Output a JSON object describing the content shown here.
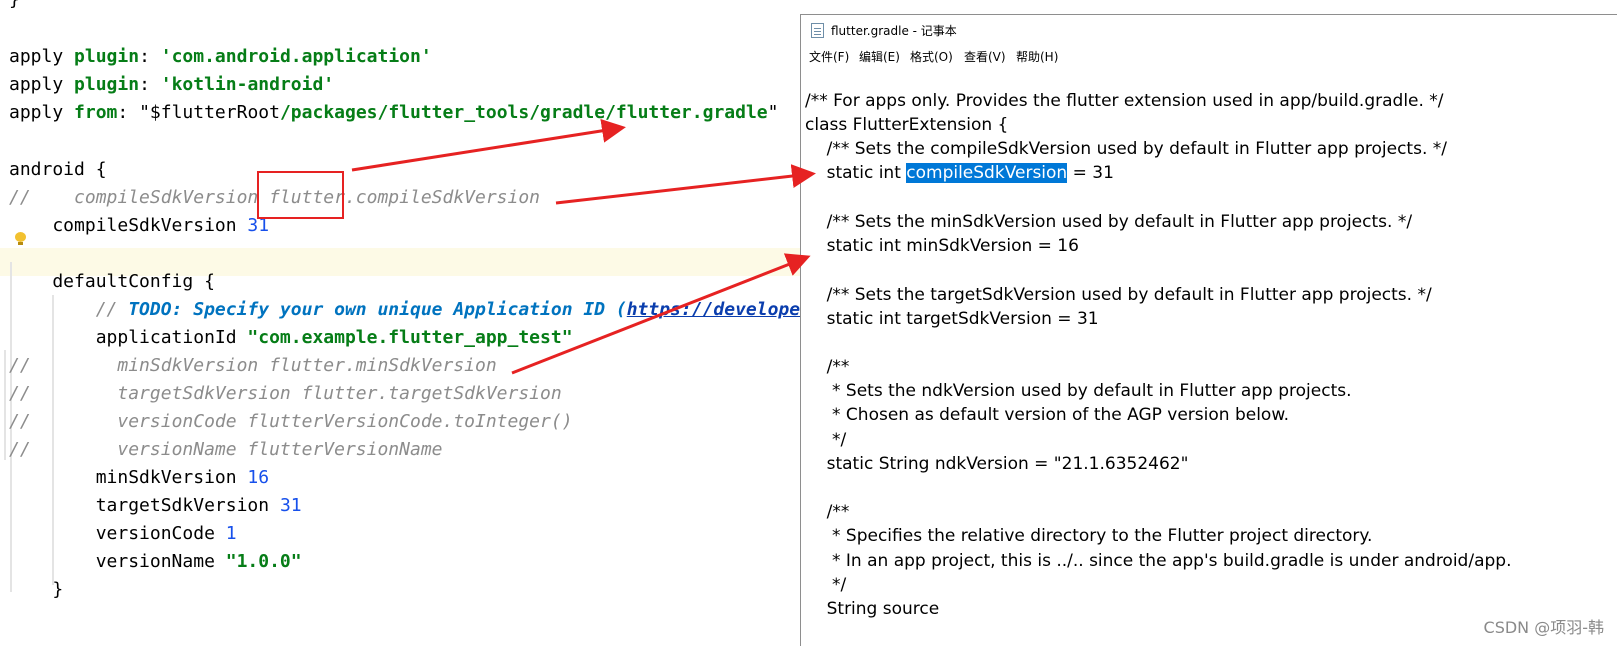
{
  "editor": {
    "line0": "}",
    "l1": {
      "a": "apply ",
      "b": "plugin",
      "c": ": ",
      "d": "'com.android.application'"
    },
    "l2": {
      "a": "apply ",
      "b": "plugin",
      "c": ": ",
      "d": "'kotlin-android'"
    },
    "l3": {
      "a": "apply ",
      "b": "from",
      "c": ": ",
      "d": "\"$flutterRoot",
      "e": "/packages/flutter_tools/gradle/flutter.gradle",
      "f": "\""
    },
    "l4": "android {",
    "l5": {
      "a": "//",
      "b": "    compileSdkVersion flutter.compileSdkVersion"
    },
    "l6": {
      "a": "    compileSdkVersion ",
      "b": "31"
    },
    "l7": "    defaultConfig {",
    "l8": {
      "a": "        // ",
      "b": "TODO: Specify your own unique Application ID (",
      "c": "https://developer"
    },
    "l9": {
      "a": "        applicationId ",
      "b": "\"com.example.flutter_app_test\""
    },
    "l10": {
      "a": "//",
      "b": "        minSdkVersion flutter.minSdkVersion"
    },
    "l11": {
      "a": "//",
      "b": "        targetSdkVersion flutter.targetSdkVersion"
    },
    "l12": {
      "a": "//",
      "b": "        versionCode flutterVersionCode.toInteger()"
    },
    "l13": {
      "a": "//",
      "b": "        versionName flutterVersionName"
    },
    "l14": {
      "a": "        minSdkVersion ",
      "b": "16"
    },
    "l15": {
      "a": "        targetSdkVersion ",
      "b": "31"
    },
    "l16": {
      "a": "        versionCode ",
      "b": "1"
    },
    "l17": {
      "a": "        versionName ",
      "b": "\"1.0.0\""
    },
    "l18": "    }"
  },
  "notepad": {
    "title": "flutter.gradle - 记事本",
    "menu": [
      "文件(F)",
      "编辑(E)",
      "格式(O)",
      "查看(V)",
      "帮助(H)"
    ],
    "lines": [
      "/** For apps only. Provides the flutter extension used in app/build.gradle. */",
      "class FlutterExtension {",
      "    /** Sets the compileSdkVersion used by default in Flutter app projects. */",
      "",
      "",
      "    /** Sets the minSdkVersion used by default in Flutter app projects. */",
      "    static int minSdkVersion = 16",
      "",
      "    /** Sets the targetSdkVersion used by default in Flutter app projects. */",
      "    static int targetSdkVersion = 31",
      "",
      "    /**",
      "     * Sets the ndkVersion used by default in Flutter app projects.",
      "     * Chosen as default version of the AGP version below.",
      "     */",
      "    static String ndkVersion = \"21.1.6352462\"",
      "",
      "    /**",
      "     * Specifies the relative directory to the Flutter project directory.",
      "     * In an app project, this is ../.. since the app's build.gradle is under android/app.",
      "     */",
      "    String source"
    ],
    "compile_line": {
      "a": "    static int ",
      "sel": "compileSdkVersion",
      "b": " = 31"
    }
  },
  "watermark": "CSDN @项羽-韩",
  "colors": {
    "arrow": "#e62222",
    "selection": "#0078d7",
    "highlight_line": "#fdfae6"
  }
}
